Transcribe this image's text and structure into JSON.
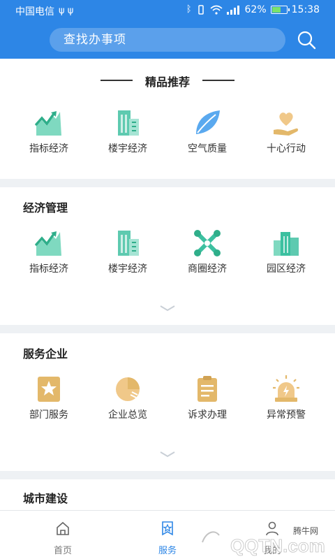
{
  "status_bar": {
    "carrier": "中国电信",
    "battery": "62%",
    "battery_level": 0.62,
    "time": "15:38"
  },
  "search": {
    "placeholder": "查找办事项"
  },
  "featured": {
    "title": "精品推荐",
    "items": [
      {
        "label": "指标经济",
        "icon": "rising-chart-icon"
      },
      {
        "label": "楼宇经济",
        "icon": "building-icon"
      },
      {
        "label": "空气质量",
        "icon": "leaf-icon"
      },
      {
        "label": "十心行动",
        "icon": "heart-hand-icon"
      }
    ]
  },
  "economy": {
    "title": "经济管理",
    "items": [
      {
        "label": "指标经济",
        "icon": "rising-chart-icon"
      },
      {
        "label": "楼宇经济",
        "icon": "building-icon"
      },
      {
        "label": "商圈经济",
        "icon": "network-icon"
      },
      {
        "label": "园区经济",
        "icon": "park-buildings-icon"
      }
    ]
  },
  "enterprise": {
    "title": "服务企业",
    "items": [
      {
        "label": "部门服务",
        "icon": "star-badge-icon"
      },
      {
        "label": "企业总览",
        "icon": "pie-chart-icon"
      },
      {
        "label": "诉求办理",
        "icon": "clipboard-icon"
      },
      {
        "label": "异常预警",
        "icon": "alarm-light-icon"
      }
    ]
  },
  "city": {
    "title": "城市建设"
  },
  "bottom_nav": [
    {
      "label": "首页",
      "icon": "home-icon"
    },
    {
      "label": "服务",
      "icon": "service-star-icon",
      "active": true
    },
    {
      "label": "我的",
      "icon": "user-icon"
    }
  ],
  "watermark": {
    "brand": "腾牛网",
    "text": "QQTN.com"
  },
  "colors": {
    "primary": "#2d86e6",
    "teal": "#3cc0a0",
    "gold": "#e3b86a",
    "blue_icon": "#55a8f0"
  }
}
